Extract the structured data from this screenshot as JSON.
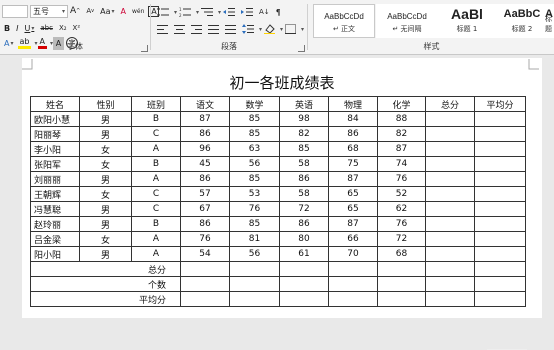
{
  "ribbon": {
    "font_group": {
      "label": "字体",
      "font_size": "五号",
      "grow_font": "A",
      "shrink_font": "A",
      "change_case": "Aa",
      "clear_format": "A",
      "phonetic": "wén",
      "border_char": "A",
      "bold": "B",
      "italic": "I",
      "underline": "U",
      "strike": "abc",
      "subscript": "X₂",
      "superscript": "X²",
      "text_effect": "A",
      "highlight": "ab",
      "font_color": "A",
      "char_shading": "A",
      "enclose": "字"
    },
    "paragraph_group": {
      "label": "段落",
      "sort": "A↓",
      "show_marks": "¶"
    },
    "styles_group": {
      "label": "样式",
      "styles": [
        {
          "preview": "AaBbCcDd",
          "name": "↵ 正文"
        },
        {
          "preview": "AaBbCcDd",
          "name": "↵ 无间隔"
        },
        {
          "preview": "AaBl",
          "name": "标题 1"
        },
        {
          "preview": "AaBbC",
          "name": "标题 2"
        },
        {
          "preview": "AaBbC",
          "name": "标题"
        }
      ]
    }
  },
  "document": {
    "title": "初一各班成绩表",
    "headers": [
      "姓名",
      "性别",
      "班别",
      "语文",
      "数学",
      "英语",
      "物理",
      "化学",
      "总分",
      "平均分"
    ],
    "rows": [
      [
        "欧阳小慧",
        "男",
        "B",
        "87",
        "85",
        "98",
        "84",
        "88",
        "",
        ""
      ],
      [
        "阳丽琴",
        "男",
        "C",
        "86",
        "85",
        "82",
        "86",
        "82",
        "",
        ""
      ],
      [
        "李小阳",
        "女",
        "A",
        "96",
        "63",
        "85",
        "68",
        "87",
        "",
        ""
      ],
      [
        "张阳军",
        "女",
        "B",
        "45",
        "56",
        "58",
        "75",
        "74",
        "",
        ""
      ],
      [
        "刘丽丽",
        "男",
        "A",
        "86",
        "85",
        "86",
        "87",
        "76",
        "",
        ""
      ],
      [
        "王朝辉",
        "女",
        "C",
        "57",
        "53",
        "58",
        "65",
        "52",
        "",
        ""
      ],
      [
        "冯慧聪",
        "男",
        "C",
        "67",
        "76",
        "72",
        "65",
        "62",
        "",
        ""
      ],
      [
        "赵玲丽",
        "男",
        "B",
        "86",
        "85",
        "86",
        "87",
        "76",
        "",
        ""
      ],
      [
        "吕金梁",
        "女",
        "A",
        "76",
        "81",
        "80",
        "66",
        "72",
        "",
        ""
      ],
      [
        "阳小阳",
        "男",
        "A",
        "54",
        "56",
        "61",
        "70",
        "68",
        "",
        ""
      ]
    ],
    "summary_rows": [
      "总分",
      "个数",
      "平均分"
    ]
  }
}
